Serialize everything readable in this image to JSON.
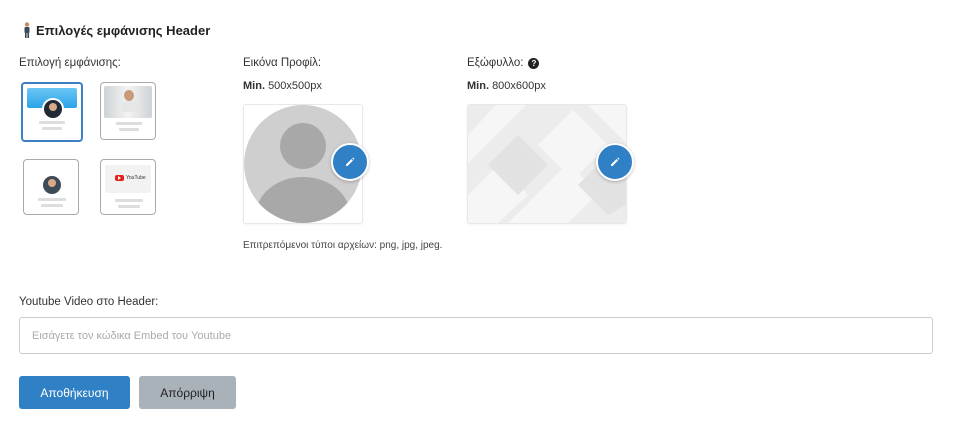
{
  "header": {
    "title": "Επιλογές εμφάνισης Header",
    "icon": "person-icon"
  },
  "display": {
    "label": "Επιλογή εμφάνισης:",
    "options": [
      {
        "id": "cover-avatar",
        "selected": true
      },
      {
        "id": "full-photo",
        "selected": false
      },
      {
        "id": "avatar-only",
        "selected": false
      },
      {
        "id": "youtube",
        "selected": false,
        "badge": "YouTube"
      }
    ]
  },
  "profile": {
    "label": "Εικόνα Προφίλ:",
    "min_prefix": "Min.",
    "min_size": "500x500px",
    "note": "Επιτρεπόμενοι τύποι αρχείων: png, jpg, jpeg."
  },
  "cover": {
    "label": "Εξώφυλλο:",
    "min_prefix": "Min.",
    "min_size": "800x600px"
  },
  "youtube": {
    "label": "Youtube Video στο Header:",
    "value": "",
    "placeholder": "Εισάγετε τον κώδικα Embed του Youtube"
  },
  "actions": {
    "save_label": "Αποθήκευση",
    "cancel_label": "Απόρριψη"
  },
  "colors": {
    "primary": "#2f80c4",
    "secondary": "#a9b1b9",
    "selected_border": "#3b7fc4"
  }
}
